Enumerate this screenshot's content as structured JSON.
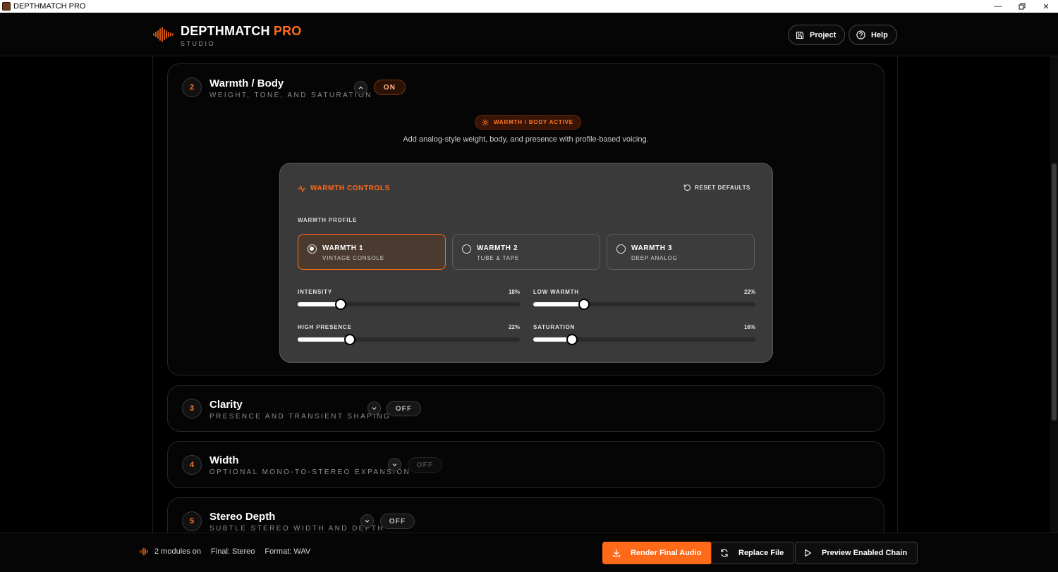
{
  "window": {
    "title": "DEPTHMATCH PRO"
  },
  "header": {
    "brand_main": "DEPTHMATCH",
    "brand_accent": "PRO",
    "brand_sub": "STUDIO",
    "project_label": "Project",
    "help_label": "Help"
  },
  "modules": [
    {
      "number": "2",
      "title": "Warmth / Body",
      "subtitle": "WEIGHT, TONE, AND SATURATION",
      "toggle": "ON",
      "expanded": true,
      "active_badge": "WARMTH / BODY ACTIVE",
      "description": "Add analog-style weight, body, and presence with profile-based voicing.",
      "controls": {
        "title": "WARMTH CONTROLS",
        "reset_label": "RESET DEFAULTS",
        "profile_label": "WARMTH PROFILE",
        "profiles": [
          {
            "name": "WARMTH 1",
            "sub": "VINTAGE CONSOLE",
            "selected": true
          },
          {
            "name": "WARMTH 2",
            "sub": "TUBE & TAPE",
            "selected": false
          },
          {
            "name": "WARMTH 3",
            "sub": "DEEP ANALOG",
            "selected": false
          }
        ],
        "sliders": [
          {
            "label": "INTENSITY",
            "value_text": "18%",
            "fraction": 0.195
          },
          {
            "label": "LOW WARMTH",
            "value_text": "22%",
            "fraction": 0.23
          },
          {
            "label": "HIGH PRESENCE",
            "value_text": "22%",
            "fraction": 0.235
          },
          {
            "label": "SATURATION",
            "value_text": "16%",
            "fraction": 0.175
          }
        ]
      }
    },
    {
      "number": "3",
      "title": "Clarity",
      "subtitle": "PRESENCE AND TRANSIENT SHAPING",
      "toggle": "OFF",
      "expanded": false
    },
    {
      "number": "4",
      "title": "Width",
      "subtitle": "OPTIONAL MONO-TO-STEREO EXPANSION",
      "toggle": "OFF",
      "expanded": false,
      "disabled": true
    },
    {
      "number": "5",
      "title": "Stereo Depth",
      "subtitle": "SUBTLE STEREO WIDTH AND DEPTH",
      "toggle": "OFF",
      "expanded": false
    }
  ],
  "footer": {
    "modules_on": "2 modules on",
    "final": "Final: Stereo",
    "format": "Format: WAV",
    "render_label": "Render Final Audio",
    "replace_label": "Replace File",
    "preview_label": "Preview Enabled Chain"
  },
  "colors": {
    "accent": "#ff6a1a",
    "background": "#000000",
    "panel": "#3a3a3a"
  }
}
